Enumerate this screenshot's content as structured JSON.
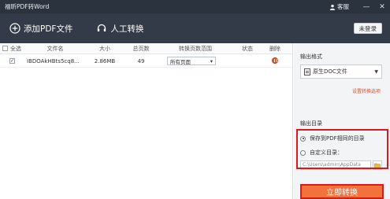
{
  "window": {
    "title": "福昕PDF转Word",
    "service_label": "客服",
    "minimize": "—",
    "close": "✕"
  },
  "toolbar": {
    "add_pdf_label": "添加PDF文件",
    "manual_label": "人工转换",
    "login_label": "未登录"
  },
  "table": {
    "headers": {
      "select_all": "全选",
      "filename": "文件名",
      "size": "大小",
      "pages": "总页数",
      "range": "转换页数范围",
      "status": "状态",
      "delete": "删除"
    },
    "rows": [
      {
        "checked": true,
        "filename": "IBDOAkHBts5cq8...",
        "size": "2.86MB",
        "pages": "49",
        "range": "所有页面",
        "status": ""
      }
    ]
  },
  "panel": {
    "format_label": "输出格式",
    "format_value": "原生DOC文件",
    "settings_link": "设置转换选项",
    "output_dir_label": "输出目录",
    "option_same_dir": "保存到PDF相同的目录",
    "option_custom_dir": "自定义目录：",
    "selected_option": "same_dir",
    "path_value": "C:\\Users\\admin\\AppData",
    "convert_label": "立即转换"
  },
  "colors": {
    "titlebar_bg": "#2b333e",
    "toolbar_bg": "#323b47",
    "accent_orange": "#f3713a",
    "highlight_red": "#d9181f"
  }
}
